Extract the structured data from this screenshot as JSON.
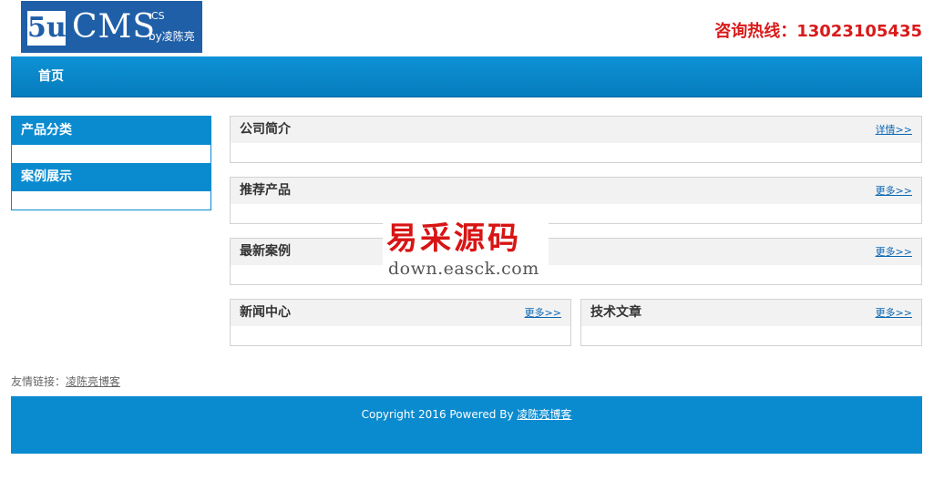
{
  "header": {
    "logo": {
      "mark": "5u",
      "name": "CMS",
      "superscript": "CS",
      "byline": "by凌陈亮"
    },
    "hotline": "咨询热线：13023105435"
  },
  "nav": {
    "items": [
      {
        "label": "首页"
      }
    ]
  },
  "sidebar": {
    "sections": [
      {
        "title": "产品分类"
      },
      {
        "title": "案例展示"
      }
    ]
  },
  "main": {
    "intro": {
      "title": "公司简介",
      "more": "详情>>"
    },
    "products": {
      "title": "推荐产品",
      "more": "更多>>"
    },
    "cases": {
      "title": "最新案例",
      "more": "更多>>"
    },
    "news": {
      "title": "新闻中心",
      "more": "更多>>"
    },
    "articles": {
      "title": "技术文章",
      "more": "更多>>"
    }
  },
  "watermark": {
    "text": "易采源码",
    "url": "down.easck.com"
  },
  "links": {
    "label": "友情链接：",
    "items": [
      {
        "label": "凌陈亮博客"
      }
    ]
  },
  "footer": {
    "copyright": "Copyright 2016 Powered By ",
    "link": "凌陈亮博客"
  },
  "colors": {
    "brand_blue": "#0a8bd0",
    "hotline_red": "#d91a1a",
    "logo_blue": "#1f5fa8"
  }
}
